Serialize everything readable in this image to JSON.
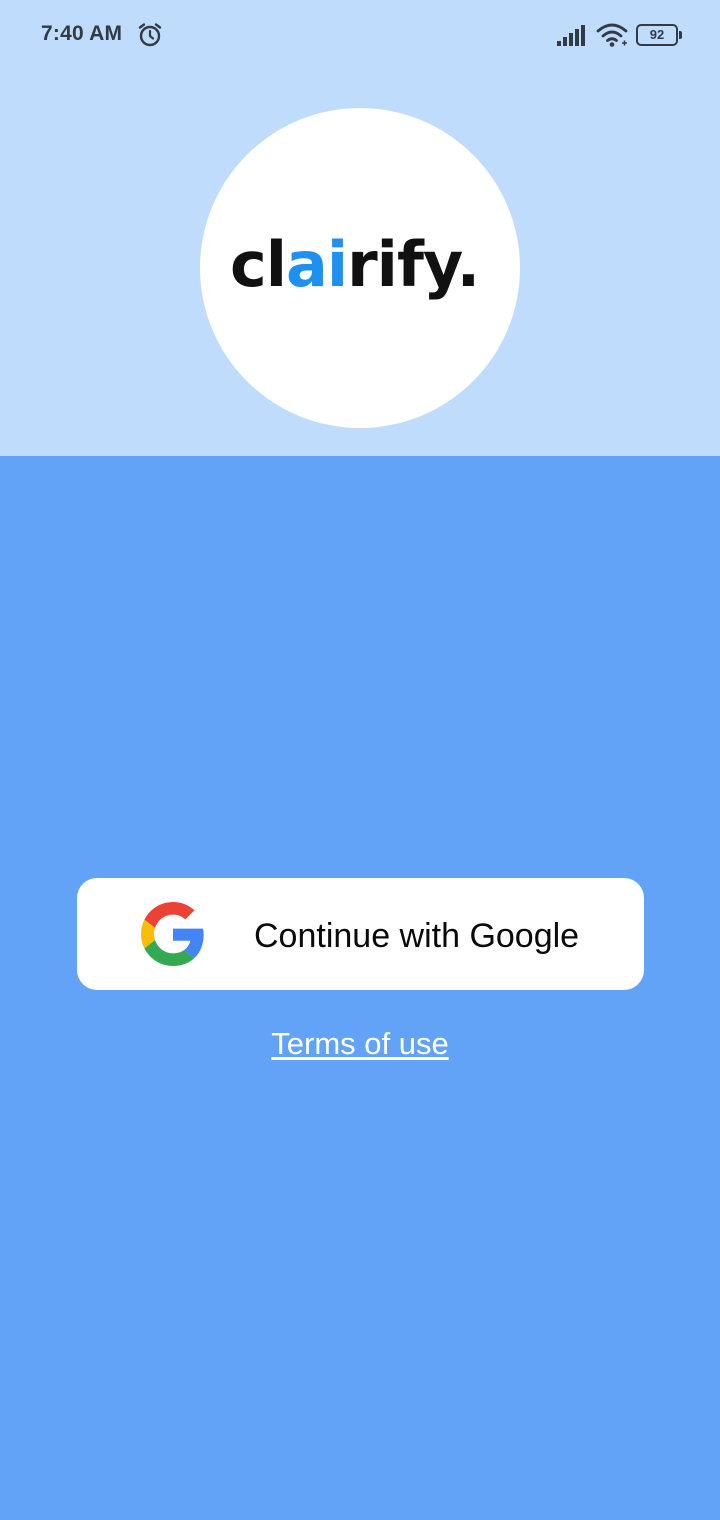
{
  "status_bar": {
    "time": "7:40 AM",
    "alarm_icon": "alarm-clock-icon",
    "signal_icon": "cellular-signal-icon",
    "wifi_icon": "wifi-icon",
    "battery_level": "92"
  },
  "logo": {
    "text_prefix": "cl",
    "text_accent": "ai",
    "text_suffix": "rify",
    "dot": ".",
    "accent_color": "#1e90f0",
    "text_color": "#111111"
  },
  "auth": {
    "google_button_label": "Continue with Google",
    "google_icon": "google-g-icon",
    "terms_label": "Terms of use"
  },
  "colors": {
    "top_background": "#bfdcfd",
    "main_background": "#62a3f8",
    "button_background": "#ffffff"
  }
}
